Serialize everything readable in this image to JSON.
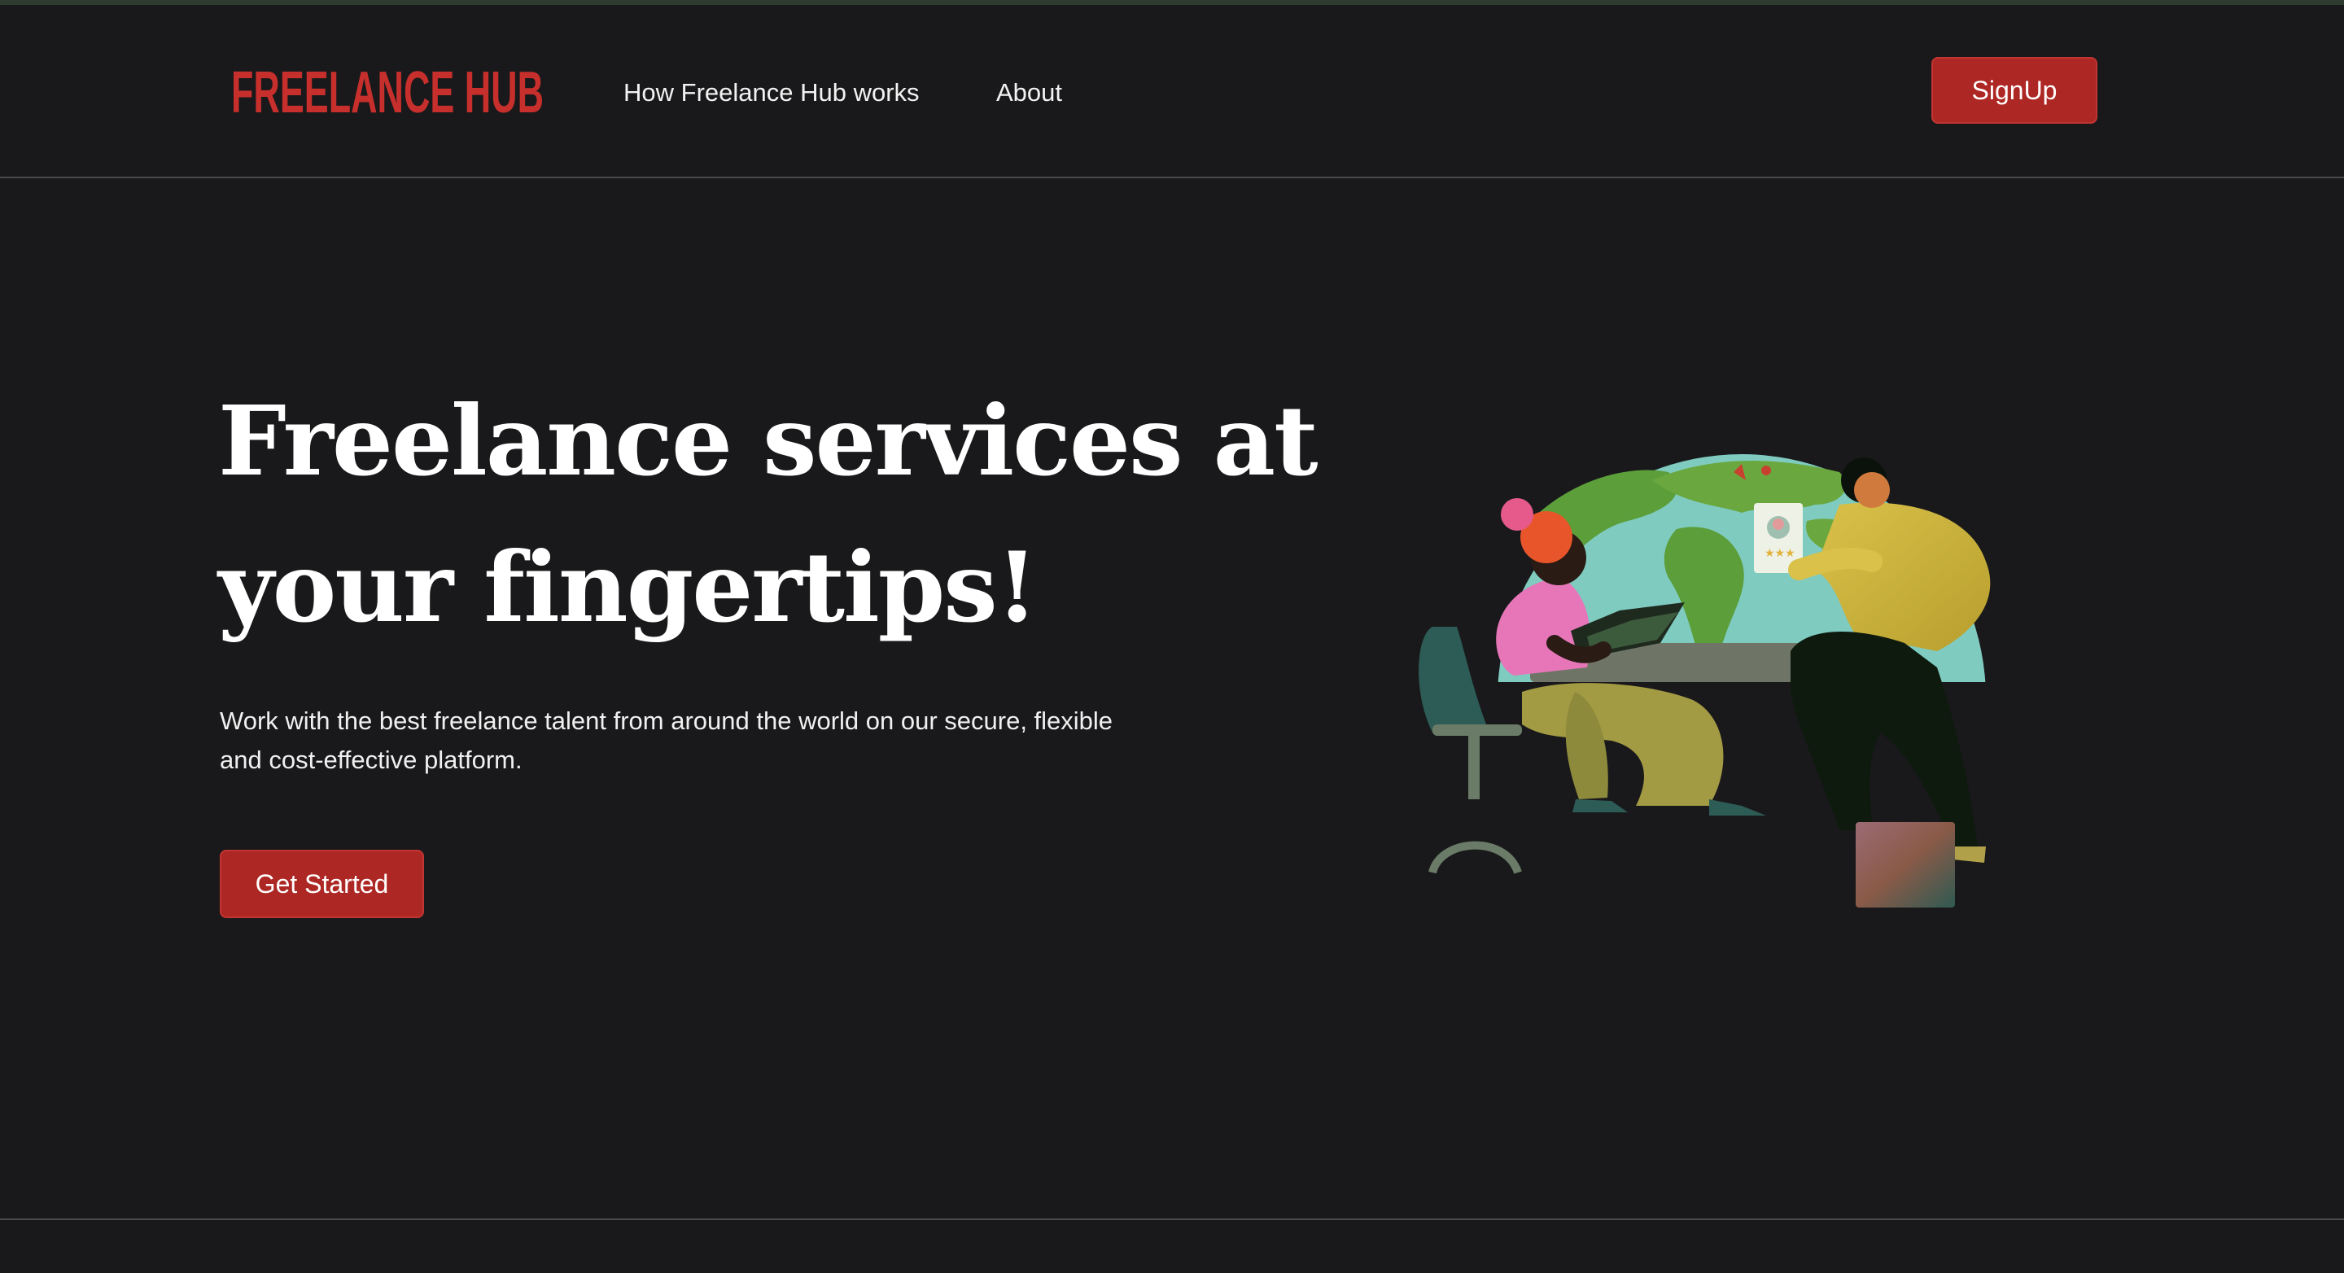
{
  "header": {
    "logo_text": "FREELANCE HUB",
    "nav": {
      "how_it_works": "How Freelance Hub works",
      "about": "About"
    },
    "signup_label": "SignUp"
  },
  "hero": {
    "title_line1": "Freelance services at",
    "title_line2": "your fingertips!",
    "subtitle_line1": "Work with the best freelance talent from around the world on our secure, flexible",
    "subtitle_line2": "and cost-effective platform.",
    "cta_label": "Get Started"
  },
  "illustration": {
    "name": "freelancers-globe-illustration"
  },
  "colors": {
    "background": "#19191b",
    "accent": "#ad2724",
    "logo": "#c62f2c",
    "divider": "#4a4a4e"
  }
}
